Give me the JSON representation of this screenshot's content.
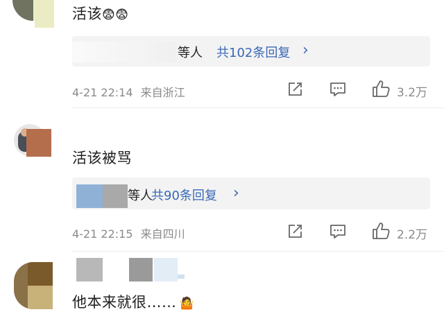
{
  "comments": [
    {
      "text": "活该",
      "emoji": "😨😨",
      "reply_who": "等人",
      "reply_count": "共102条回复",
      "chevron": "›",
      "time": "4-21 22:14",
      "location": "来自浙江",
      "likes": "3.2万"
    },
    {
      "text": "活该被骂",
      "reply_who": "等人",
      "reply_count": "共90条回复",
      "chevron": "›",
      "time": "4-21 22:15",
      "location": "来自四川",
      "likes": "2.2万"
    },
    {
      "text": "他本来就很……",
      "emoji": "🤷"
    }
  ],
  "icons": {
    "share": "share-icon",
    "comment": "comment-icon",
    "like": "thumbs-up-icon"
  },
  "colors": {
    "link_blue": "#3a68b5",
    "meta_gray": "#8a8a8a",
    "reply_bg": "#f3f3f3"
  }
}
